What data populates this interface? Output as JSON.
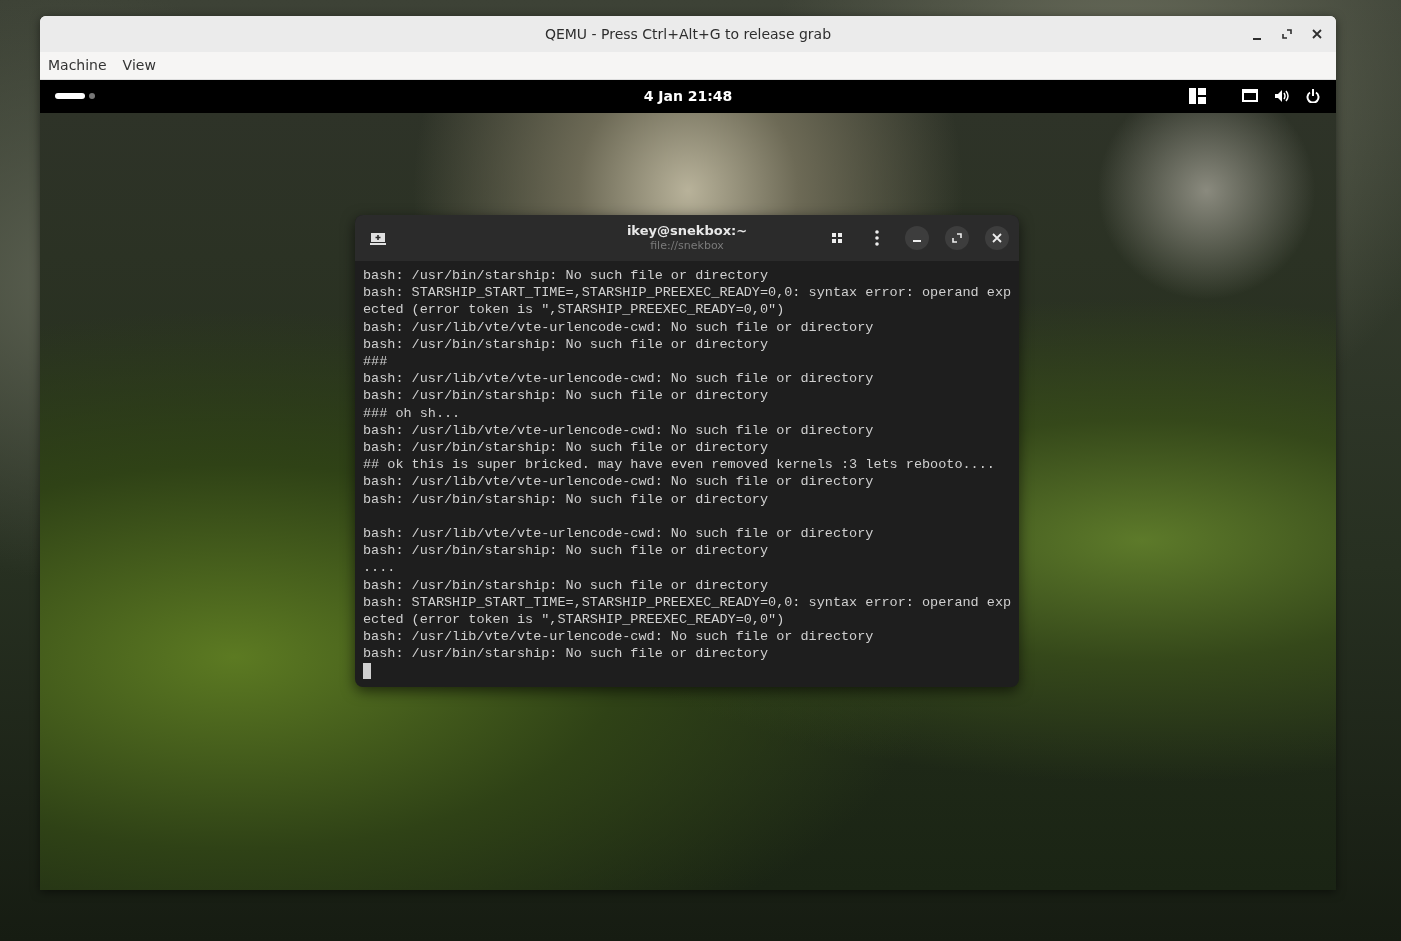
{
  "qemu_window": {
    "title": "QEMU - Press Ctrl+Alt+G to release grab",
    "menu": [
      "Machine",
      "View"
    ]
  },
  "top_bar": {
    "workspaces": [
      {
        "selected": true
      },
      {
        "selected": false
      }
    ],
    "clock": "4 Jan  21:48"
  },
  "terminal": {
    "title": "ikey@snekbox:~",
    "subtitle": "file://snekbox",
    "lines": [
      {
        "text": "bash: /usr/bin/starship: No such file or directory"
      },
      {
        "text": "bash: STARSHIP_START_TIME=,STARSHIP_PREEXEC_READY=0,0: syntax error: operand exp"
      },
      {
        "text": "ected (error token is \",STARSHIP_PREEXEC_READY=0,0\")"
      },
      {
        "text": "bash: /usr/lib/vte/vte-urlencode-cwd: No such file or directory"
      },
      {
        "text": "bash: /usr/bin/starship: No such file or directory"
      },
      {
        "text": "###"
      },
      {
        "text": "bash: /usr/lib/vte/vte-urlencode-cwd: No such file or directory"
      },
      {
        "text": "bash: /usr/bin/starship: No such file or directory"
      },
      {
        "text": "### oh sh..."
      },
      {
        "text": "bash: /usr/lib/vte/vte-urlencode-cwd: No such file or directory"
      },
      {
        "text": "bash: /usr/bin/starship: No such file or directory"
      },
      {
        "text": "## ok this is super bricked. may have even removed kernels :3 lets rebooto...."
      },
      {
        "text": "bash: /usr/lib/vte/vte-urlencode-cwd: No such file or directory"
      },
      {
        "text": "bash: /usr/bin/starship: No such file or directory"
      },
      {
        "text": "bash: /usr/lib/vte/vte-urlencode-cwd: No such file or directory",
        "blank_before": true
      },
      {
        "text": "bash: /usr/bin/starship: No such file or directory"
      },
      {
        "text": "...."
      },
      {
        "text": "bash: /usr/bin/starship: No such file or directory"
      },
      {
        "text": "bash: STARSHIP_START_TIME=,STARSHIP_PREEXEC_READY=0,0: syntax error: operand exp"
      },
      {
        "text": "ected (error token is \",STARSHIP_PREEXEC_READY=0,0\")"
      },
      {
        "text": "bash: /usr/lib/vte/vte-urlencode-cwd: No such file or directory"
      },
      {
        "text": "bash: /usr/bin/starship: No such file or directory"
      }
    ]
  }
}
